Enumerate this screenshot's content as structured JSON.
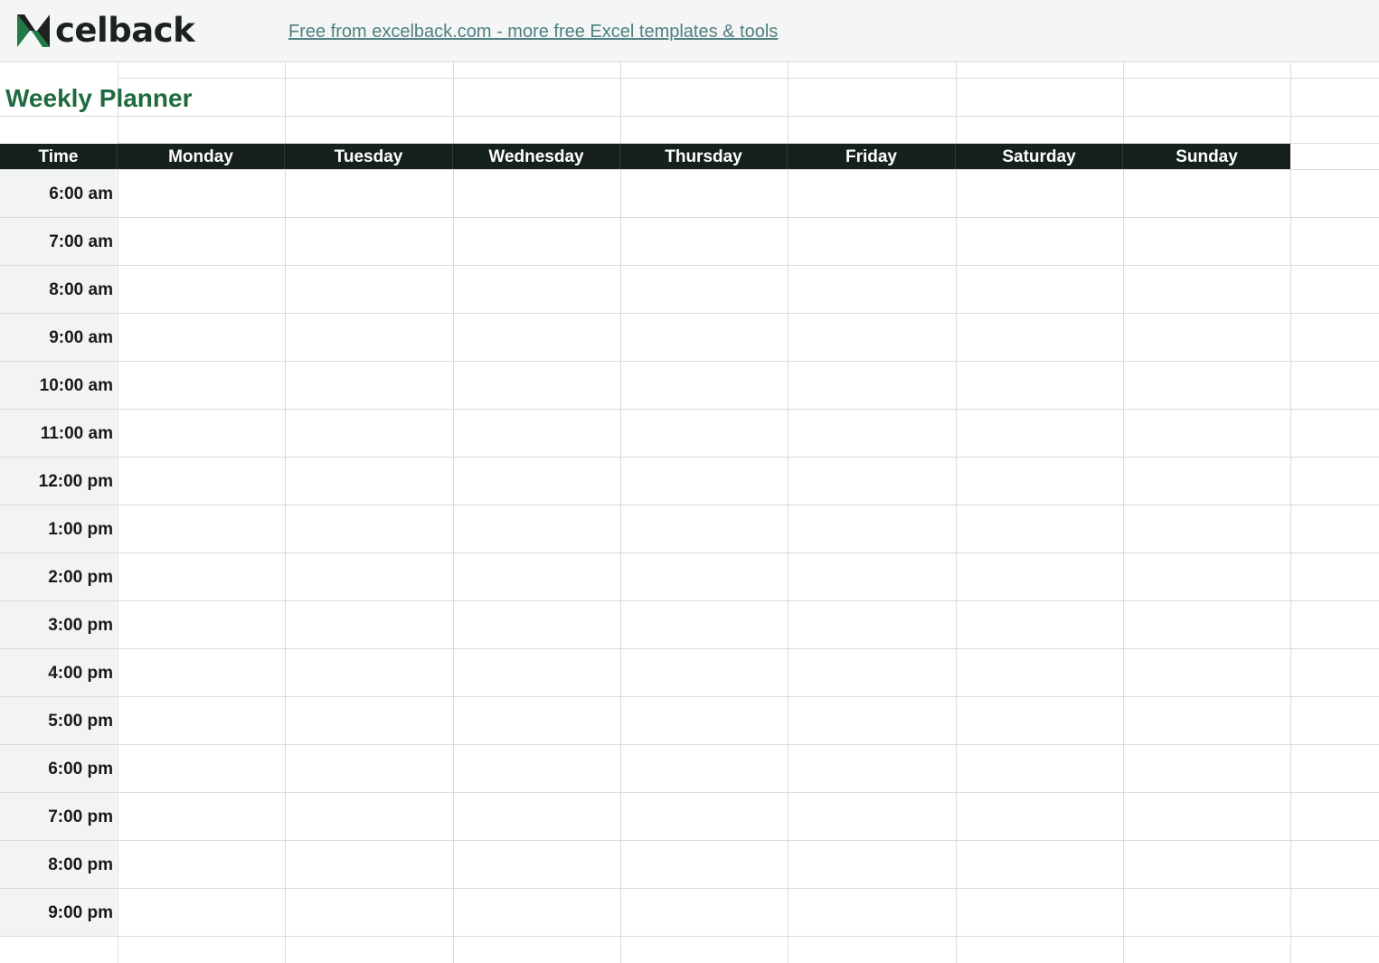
{
  "banner": {
    "logo_text": "celback",
    "logo_icon": "excelback-x-logo-icon",
    "link_text": "Free from excelback.com - more free Excel templates & tools"
  },
  "title": "Weekly Planner",
  "header": [
    "Time",
    "Monday",
    "Tuesday",
    "Wednesday",
    "Thursday",
    "Friday",
    "Saturday",
    "Sunday"
  ],
  "times": [
    "6:00 am",
    "7:00 am",
    "8:00 am",
    "9:00 am",
    "10:00 am",
    "11:00 am",
    "12:00 pm",
    "1:00 pm",
    "2:00 pm",
    "3:00 pm",
    "4:00 pm",
    "5:00 pm",
    "6:00 pm",
    "7:00 pm",
    "8:00 pm",
    "9:00 pm"
  ],
  "colors": {
    "title": "#1f6b3f",
    "header_bg": "#17211c",
    "logo_green": "#1f7a46",
    "logo_dark": "#1d2220",
    "link": "#4f7f80",
    "time_bg": "#f2f4f3"
  }
}
